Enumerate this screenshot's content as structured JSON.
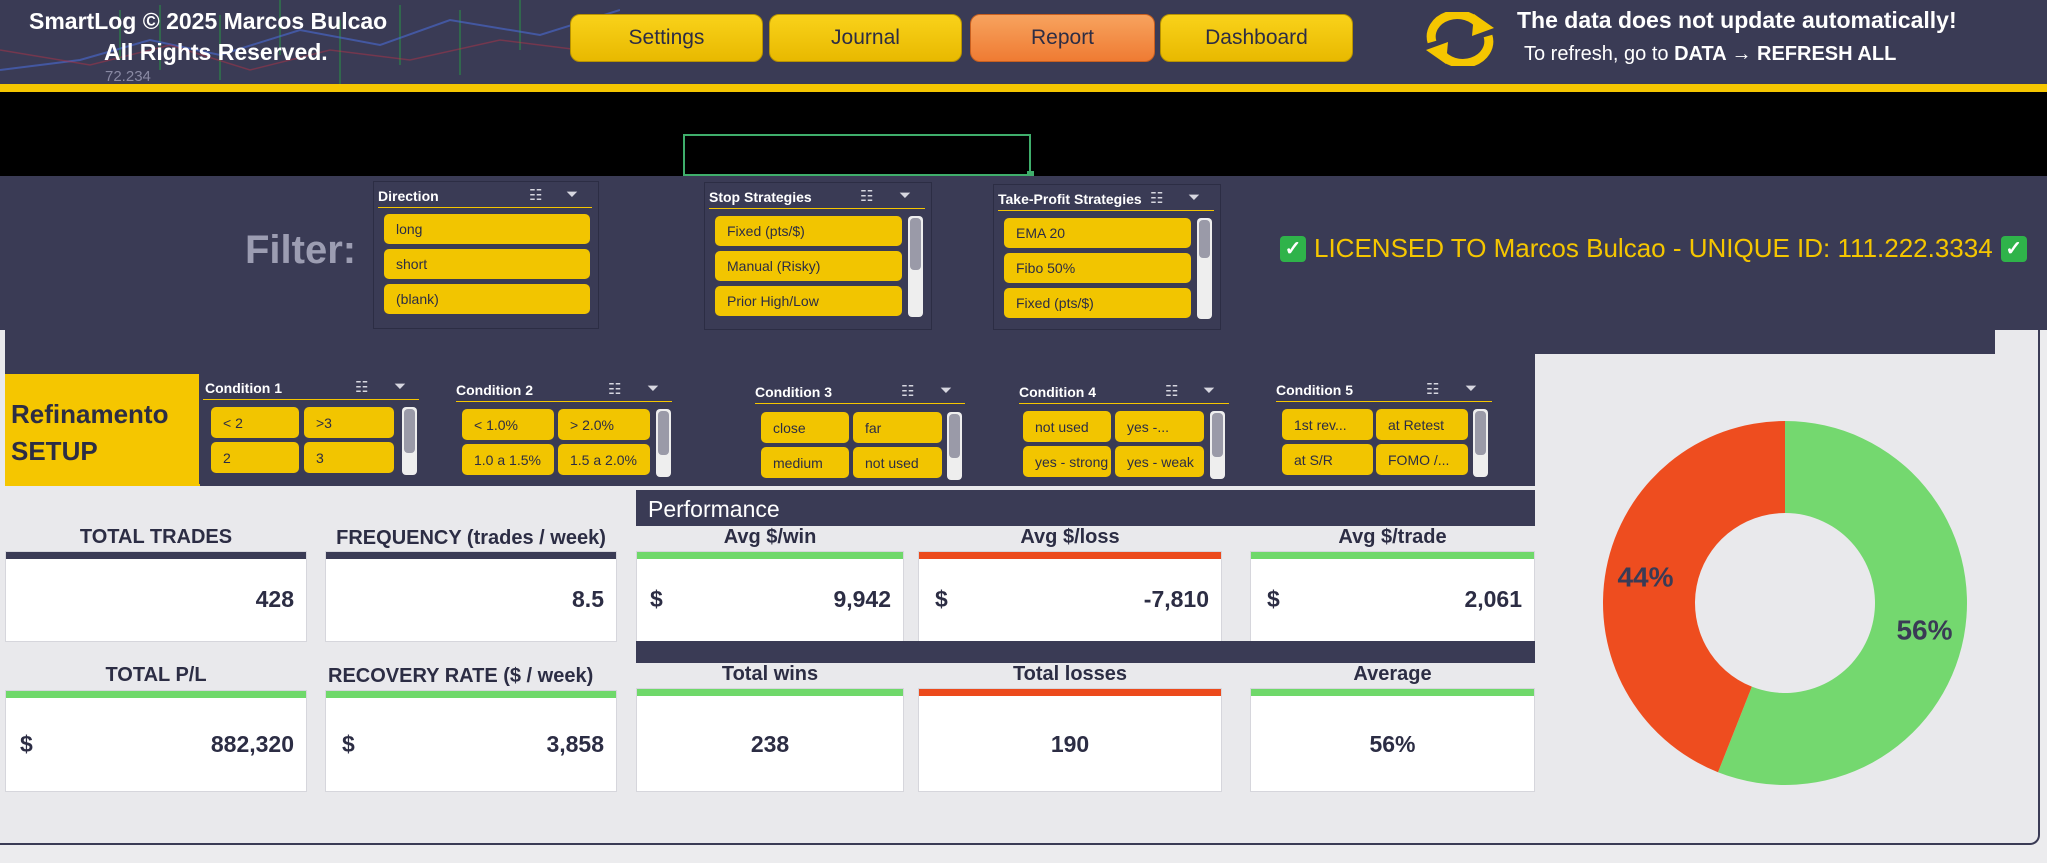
{
  "header": {
    "copyright_line1": "SmartLog © 2025 Marcos Bulcao",
    "copyright_line2": "All Rights Reserved.",
    "bg_number": "72.234",
    "nav": [
      {
        "label": "Settings",
        "active": false
      },
      {
        "label": "Journal",
        "active": false
      },
      {
        "label": "Report",
        "active": true
      },
      {
        "label": "Dashboard",
        "active": false
      }
    ],
    "notice_title": "The data does not update automatically!",
    "notice_prefix": "To refresh, go to ",
    "notice_bold": "DATA → REFRESH ALL",
    "refresh_icon": "refresh-icon"
  },
  "filter": {
    "label": "Filter:",
    "slicers": [
      {
        "title": "Direction",
        "items": [
          "long",
          "short",
          "(blank)"
        ],
        "scroll": false
      },
      {
        "title": "Stop Strategies",
        "items": [
          "Fixed (pts/$)",
          "Manual (Risky)",
          "Prior High/Low"
        ],
        "scroll": true
      },
      {
        "title": "Take-Profit Strategies",
        "items": [
          "EMA 20",
          "Fibo 50%",
          "Fixed (pts/$)"
        ],
        "scroll": true
      }
    ],
    "license_text": "LICENSED TO Marcos Bulcao - UNIQUE ID: 111.222.3334"
  },
  "setup": {
    "label_line1": "Refinamento",
    "label_line2": "SETUP",
    "conditions": [
      {
        "title": "Condition 1",
        "items": [
          "< 2",
          ">3",
          "2",
          "3"
        ]
      },
      {
        "title": "Condition 2",
        "items": [
          "< 1.0%",
          "> 2.0%",
          "1.0 a 1.5%",
          "1.5 a 2.0%"
        ]
      },
      {
        "title": "Condition 3",
        "items": [
          "close",
          "far",
          "medium",
          "not used"
        ]
      },
      {
        "title": "Condition 4",
        "items": [
          "not used",
          "yes -...",
          "yes - strong",
          "yes - weak"
        ]
      },
      {
        "title": "Condition 5",
        "items": [
          "1st rev...",
          "at Retest",
          "at S/R",
          "FOMO /..."
        ]
      }
    ]
  },
  "kpis": {
    "total_trades": {
      "title": "TOTAL TRADES",
      "value": "428"
    },
    "frequency": {
      "title": "FREQUENCY (trades / week)",
      "value": "8.5"
    },
    "total_pl": {
      "title": "TOTAL P/L",
      "currency": "$",
      "value": "882,320"
    },
    "recovery": {
      "title": "RECOVERY RATE ($ / week)",
      "currency": "$",
      "value": "3,858"
    }
  },
  "performance": {
    "title": "Performance",
    "avg_win": {
      "title": "Avg $/win",
      "currency": "$",
      "value": "9,942"
    },
    "avg_loss": {
      "title": "Avg $/loss",
      "currency": "$",
      "value": "-7,810"
    },
    "avg_trade": {
      "title": "Avg $/trade",
      "currency": "$",
      "value": "2,061"
    },
    "total_wins": {
      "title": "Total wins",
      "value": "238"
    },
    "total_losses": {
      "title": "Total losses",
      "value": "190"
    },
    "average": {
      "title": "Average",
      "value": "56%"
    }
  },
  "colors": {
    "green": "#6fd86a",
    "red": "#ec4a1c",
    "yellow": "#f5c600",
    "navy": "#3a3b55"
  },
  "chart_data": {
    "type": "pie",
    "labels": [
      "44%",
      "56%"
    ],
    "values": [
      44,
      56
    ],
    "colors": [
      "#ee4d1f",
      "#74d86f"
    ]
  }
}
